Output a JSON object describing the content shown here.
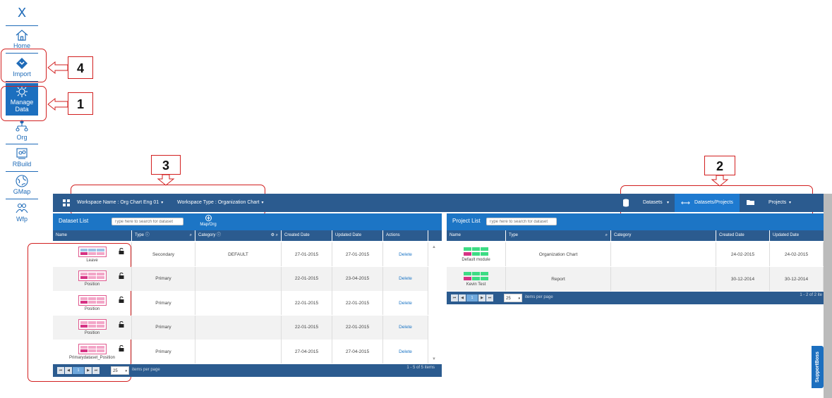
{
  "sidebar": {
    "logo": "X",
    "items": [
      {
        "label": "Home",
        "icon": "home-icon"
      },
      {
        "label": "Import",
        "icon": "import-icon"
      },
      {
        "label": "Manage Data",
        "icon": "manage-data-icon"
      },
      {
        "label": "Org",
        "icon": "org-chart-icon"
      },
      {
        "label": "RBuild",
        "icon": "rbuild-icon"
      },
      {
        "label": "GMap",
        "icon": "globe-icon"
      },
      {
        "label": "Wfp",
        "icon": "workforce-icon"
      }
    ]
  },
  "annotations": [
    "1",
    "2",
    "3",
    "4"
  ],
  "topbar": {
    "workspace_name": "Workspace Name : Org Chart Eng 01",
    "workspace_type": "Workspace Type : Organization Chart",
    "datasets": "Datasets",
    "datasets_projects": "Datasets/Projects",
    "projects": "Projects"
  },
  "dataset_panel": {
    "title": "Dataset List",
    "search_placeholder": "Type here to search for dataset",
    "map_org": "Map/Org",
    "columns": [
      "Name",
      "Type",
      "Category",
      "Created Date",
      "Updated Date",
      "Actions"
    ],
    "rows": [
      {
        "name": "Leave",
        "type": "Secondary",
        "category": "DEFAULT",
        "created": "27-01-2015",
        "updated": "27-01-2015",
        "action": "Delete"
      },
      {
        "name": "Position",
        "type": "Primary",
        "category": "",
        "created": "22-01-2015",
        "updated": "23-04-2015",
        "action": "Delete"
      },
      {
        "name": "Position",
        "type": "Primary",
        "category": "",
        "created": "22-01-2015",
        "updated": "22-01-2015",
        "action": "Delete"
      },
      {
        "name": "Position",
        "type": "Primary",
        "category": "",
        "created": "22-01-2015",
        "updated": "22-01-2015",
        "action": "Delete"
      },
      {
        "name": "Primarydataset_Position",
        "type": "Primary",
        "category": "",
        "created": "27-04-2015",
        "updated": "27-04-2015",
        "action": "Delete"
      }
    ],
    "page": "1",
    "per_page": "25",
    "per_page_label": "items per page",
    "summary": "1 - 5 of 5 items"
  },
  "project_panel": {
    "title": "Project List",
    "search_placeholder": "Type here to search for dataset",
    "columns": [
      "Name",
      "Type",
      "Category",
      "Created Date",
      "Updated Date"
    ],
    "rows": [
      {
        "name": "Default module",
        "type": "Organization Chart",
        "category": "",
        "created": "24-02-2015",
        "updated": "24-02-2015"
      },
      {
        "name": "Kevin Test",
        "type": "Report",
        "category": "",
        "created": "30-12-2014",
        "updated": "30-12-2014"
      }
    ],
    "page": "1",
    "per_page": "25",
    "per_page_label": "items per page",
    "summary": "1 - 2 of 2 ite"
  },
  "support": "SupportBoss",
  "colors": {
    "accent": "#1c75c5",
    "header": "#2b5b8f",
    "annotation": "#d21f1f"
  }
}
